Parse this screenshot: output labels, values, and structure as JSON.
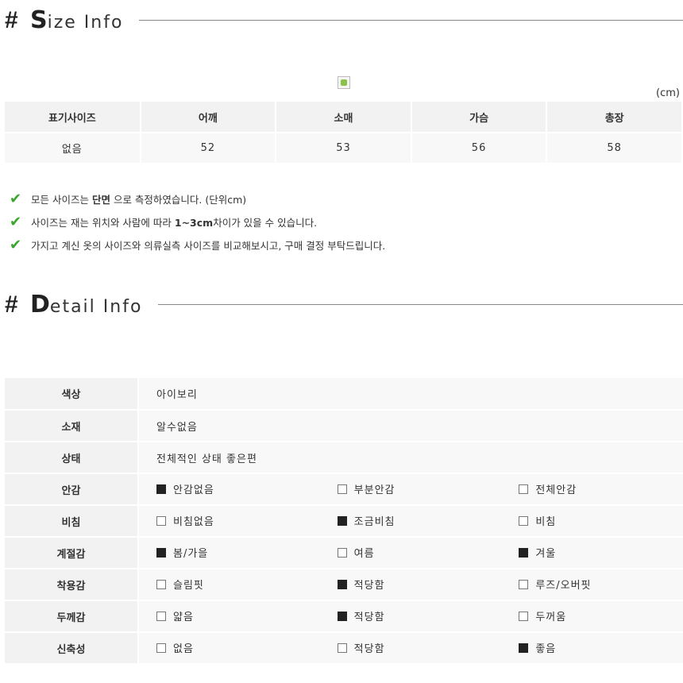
{
  "size_section": {
    "hash": "#",
    "title_cap": "S",
    "title_rest": "ize Info",
    "unit": "(cm)",
    "headers": [
      "표기사이즈",
      "어깨",
      "소매",
      "가슴",
      "총장"
    ],
    "row": [
      "없음",
      "52",
      "53",
      "56",
      "58"
    ]
  },
  "notes": [
    {
      "pre": "모든 사이즈는 ",
      "bold": "단면",
      "post": " 으로 측정하였습니다. (단위cm)"
    },
    {
      "pre": "사이즈는 재는 위치와 사람에 따라 ",
      "bold": "1~3cm",
      "post": "차이가 있을 수 있습니다."
    },
    {
      "pre": "가지고 계신 옷의 사이즈와 의류실측 사이즈를 비교해보시고, 구매 결정 부탁드립니다.",
      "bold": "",
      "post": ""
    }
  ],
  "detail_section": {
    "hash": "#",
    "title_cap": "D",
    "title_rest": "etail Info",
    "simple_rows": [
      {
        "label": "색상",
        "value": "아이보리"
      },
      {
        "label": "소재",
        "value": "알수없음"
      },
      {
        "label": "상태",
        "value": "전체적인 상태 좋은편"
      }
    ],
    "option_rows": [
      {
        "label": "안감",
        "options": [
          {
            "text": "안감없음",
            "checked": true
          },
          {
            "text": "부분안감",
            "checked": false
          },
          {
            "text": "전체안감",
            "checked": false
          }
        ]
      },
      {
        "label": "비침",
        "options": [
          {
            "text": "비침없음",
            "checked": false
          },
          {
            "text": "조금비침",
            "checked": true
          },
          {
            "text": "비침",
            "checked": false
          }
        ]
      },
      {
        "label": "계절감",
        "options": [
          {
            "text": "봄/가을",
            "checked": true
          },
          {
            "text": "여름",
            "checked": false
          },
          {
            "text": "겨울",
            "checked": true
          }
        ]
      },
      {
        "label": "착용감",
        "options": [
          {
            "text": "슬림핏",
            "checked": false
          },
          {
            "text": "적당함",
            "checked": true
          },
          {
            "text": "루즈/오버핏",
            "checked": false
          }
        ]
      },
      {
        "label": "두께감",
        "options": [
          {
            "text": "얇음",
            "checked": false
          },
          {
            "text": "적당함",
            "checked": true
          },
          {
            "text": "두꺼움",
            "checked": false
          }
        ]
      },
      {
        "label": "신축성",
        "options": [
          {
            "text": "없음",
            "checked": false
          },
          {
            "text": "적당함",
            "checked": false
          },
          {
            "text": "좋음",
            "checked": true
          }
        ]
      }
    ]
  }
}
